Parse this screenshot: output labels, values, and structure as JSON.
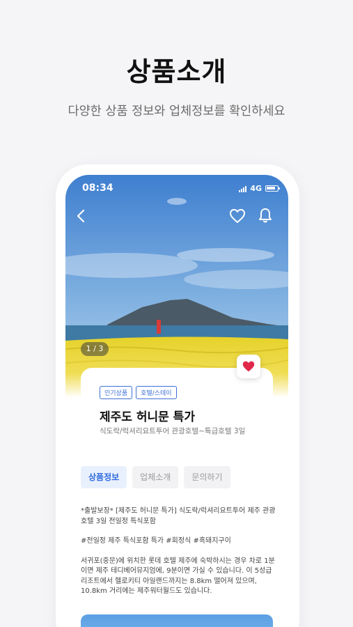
{
  "promo": {
    "title": "상품소개",
    "subtitle": "다양한 상품 정보와 업체정보를 확인하세요"
  },
  "status_bar": {
    "time": "08:34",
    "network": "4G"
  },
  "icons": {
    "back": "chevron-left-icon",
    "wishlist": "heart-outline-icon",
    "notifications": "bell-icon",
    "favorite": "heart-filled-icon"
  },
  "gallery": {
    "counter": "1 / 3"
  },
  "product": {
    "tags": [
      "인기상품",
      "호텔/스테이"
    ],
    "title": "제주도 허니문 특가",
    "description": "식도락/럭셔리요트투어 관광호텔~특급호텔 3일"
  },
  "tabs": [
    {
      "label": "상품정보",
      "active": true
    },
    {
      "label": "업체소개",
      "active": false
    },
    {
      "label": "문의하기",
      "active": false
    }
  ],
  "details": {
    "paragraph1": "*출발보장* [제주도 허니문 특가] 식도락/럭셔리요트투어 제주 관광호텔 3일 전일정 특식포함",
    "paragraph2": "#전일정 제주 특식포함 특가 #회정식 #흑돼지구이",
    "paragraph3": "서귀포(중문)에 위치한 롯데 호텔 제주에 숙박하시는 경우 차로 1분이면 제주 테디베어뮤지엄에, 9분이면 가실 수 있습니다. 이 5성급 리조트에서 헬로키티 아일랜드까지는 8.8km 떨어져 있으며, 10.8km 거리에는 제주워터월드도 있습니다."
  },
  "colors": {
    "accent": "#2f6ae0",
    "favorite": "#e0284a",
    "tab_inactive_bg": "#f2f2f4"
  }
}
